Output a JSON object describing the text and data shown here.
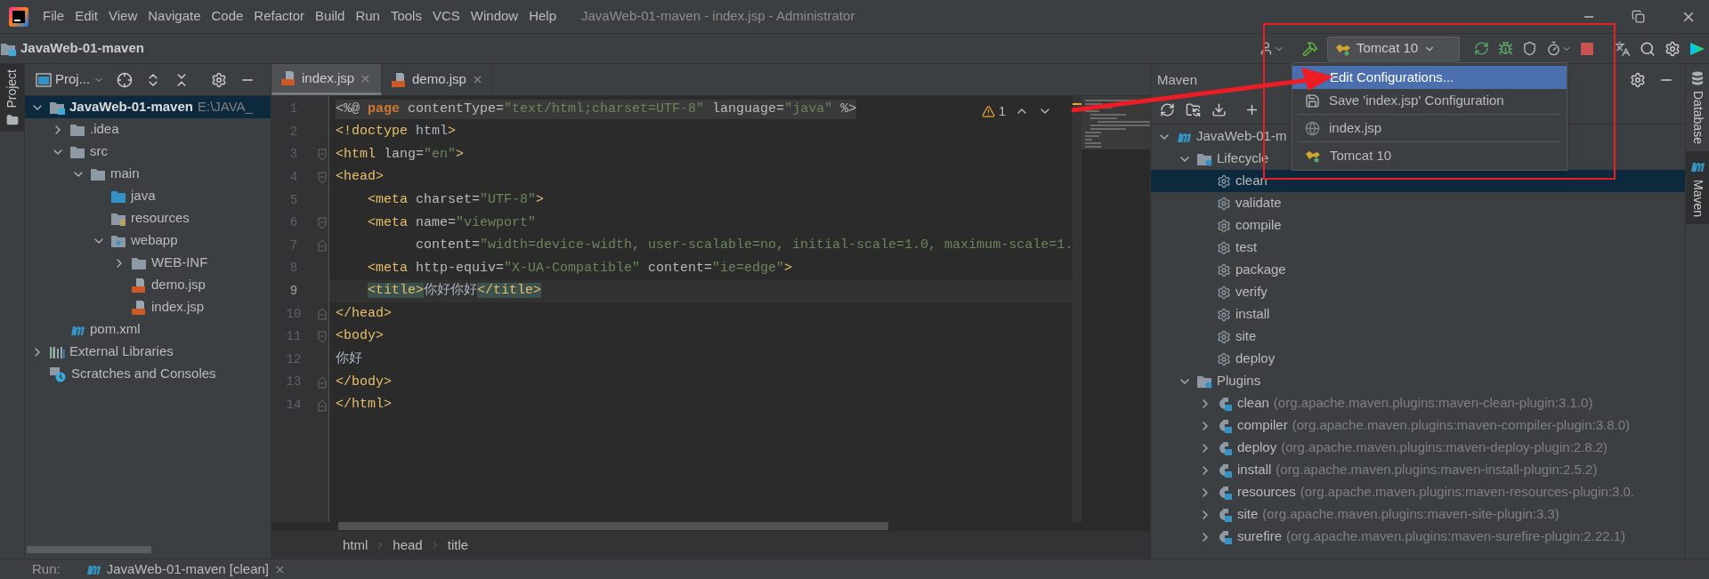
{
  "window": {
    "title": "JavaWeb-01-maven - index.jsp - Administrator"
  },
  "menu": {
    "items": [
      "File",
      "Edit",
      "View",
      "Navigate",
      "Code",
      "Refactor",
      "Build",
      "Run",
      "Tools",
      "VCS",
      "Window",
      "Help"
    ]
  },
  "navbar": {
    "project": "JavaWeb-01-maven"
  },
  "run_toolbar": {
    "configuration": "Tomcat 10"
  },
  "run_menu": {
    "items": [
      {
        "label": "Edit Configurations...",
        "kind": "edit",
        "selected": true
      },
      {
        "label": "Save 'index.jsp' Configuration",
        "kind": "save",
        "selected": false
      },
      {
        "label": "index.jsp",
        "kind": "jsp",
        "selected": false
      },
      {
        "label": "Tomcat 10",
        "kind": "tomcat",
        "selected": false
      }
    ]
  },
  "left_strip": {
    "tabs": [
      {
        "label": "Project",
        "selected": true
      }
    ]
  },
  "project_panel": {
    "title": "Proj...",
    "tree": [
      {
        "label": "JavaWeb-01-maven",
        "detail": "E:\\JAVA_",
        "kind": "module",
        "expanded": true,
        "selected": true,
        "children": [
          {
            "label": ".idea",
            "kind": "folder",
            "expanded": false,
            "selected": false
          },
          {
            "label": "src",
            "kind": "folder",
            "expanded": true,
            "selected": false,
            "children": [
              {
                "label": "main",
                "kind": "folder",
                "expanded": true,
                "selected": false,
                "children": [
                  {
                    "label": "java",
                    "kind": "source",
                    "selected": false
                  },
                  {
                    "label": "resources",
                    "kind": "resources",
                    "selected": false
                  },
                  {
                    "label": "webapp",
                    "kind": "web",
                    "expanded": true,
                    "selected": false,
                    "children": [
                      {
                        "label": "WEB-INF",
                        "kind": "folder",
                        "expanded": false,
                        "selected": false
                      },
                      {
                        "label": "demo.jsp",
                        "kind": "jsp",
                        "selected": false
                      },
                      {
                        "label": "index.jsp",
                        "kind": "jsp",
                        "selected": false
                      }
                    ]
                  }
                ]
              }
            ]
          },
          {
            "label": "pom.xml",
            "kind": "maven",
            "selected": false
          }
        ]
      },
      {
        "label": "External Libraries",
        "kind": "libraries",
        "expanded": false,
        "selected": false
      },
      {
        "label": "Scratches and Consoles",
        "kind": "scratches",
        "selected": false
      }
    ]
  },
  "editor": {
    "tabs": [
      {
        "label": "index.jsp",
        "selected": true
      },
      {
        "label": "demo.jsp",
        "selected": false
      }
    ],
    "warnings": "1",
    "lines": [
      {
        "number": "1",
        "kind": "directive",
        "current": false,
        "tokens": [
          {
            "text": "<%@ ",
            "kind": "punct"
          },
          {
            "text": "page",
            "kind": "keyword"
          },
          {
            "text": " contentType=",
            "kind": "attr"
          },
          {
            "text": "\"text/html;charset=UTF-8\"",
            "kind": "value"
          },
          {
            "text": " language=",
            "kind": "attr"
          },
          {
            "text": "\"java\"",
            "kind": "value"
          },
          {
            "text": " %>",
            "kind": "punct"
          }
        ]
      },
      {
        "number": "2",
        "current": false,
        "tokens": [
          {
            "text": "<!doctype",
            "kind": "tag"
          },
          {
            "text": " html",
            "kind": "text"
          },
          {
            "text": ">",
            "kind": "tag"
          }
        ]
      },
      {
        "number": "3",
        "fold_start": true,
        "current": false,
        "tokens": [
          {
            "text": "<html",
            "kind": "tag"
          },
          {
            "text": " lang=",
            "kind": "attr"
          },
          {
            "text": "\"en\"",
            "kind": "value"
          },
          {
            "text": ">",
            "kind": "tag"
          }
        ]
      },
      {
        "number": "4",
        "fold_start": true,
        "current": false,
        "tokens": [
          {
            "text": "<head>",
            "kind": "tag"
          }
        ]
      },
      {
        "number": "5",
        "current": false,
        "tokens": [
          {
            "text": "    <meta",
            "kind": "tag"
          },
          {
            "text": " charset=",
            "kind": "attr"
          },
          {
            "text": "\"UTF-8\"",
            "kind": "value"
          },
          {
            "text": ">",
            "kind": "tag"
          }
        ]
      },
      {
        "number": "6",
        "fold_start": true,
        "current": false,
        "tokens": [
          {
            "text": "    <meta",
            "kind": "tag"
          },
          {
            "text": " name=",
            "kind": "attr"
          },
          {
            "text": "\"viewport\"",
            "kind": "value"
          }
        ]
      },
      {
        "number": "7",
        "fold_end": true,
        "current": false,
        "tokens": [
          {
            "text": "          content=",
            "kind": "attr"
          },
          {
            "text": "\"width=device-width, user-scalable=no, initial-scale=1.0, maximum-scale=1.",
            "kind": "value"
          }
        ]
      },
      {
        "number": "8",
        "current": false,
        "tokens": [
          {
            "text": "    <meta",
            "kind": "tag"
          },
          {
            "text": " http-equiv=",
            "kind": "attr"
          },
          {
            "text": "\"X-UA-Compatible\"",
            "kind": "value"
          },
          {
            "text": " content=",
            "kind": "attr"
          },
          {
            "text": "\"ie=edge\"",
            "kind": "value"
          },
          {
            "text": ">",
            "kind": "tag"
          }
        ]
      },
      {
        "number": "9",
        "current": true,
        "indented": true,
        "tokens": [
          {
            "text": "<title>",
            "kind": "tag_match"
          },
          {
            "text": "你好你好",
            "kind": "text"
          },
          {
            "text": "</title>",
            "kind": "tag_match"
          }
        ]
      },
      {
        "number": "10",
        "fold_end": true,
        "current": false,
        "tokens": [
          {
            "text": "</head>",
            "kind": "tag"
          }
        ]
      },
      {
        "number": "11",
        "fold_start": true,
        "current": false,
        "tokens": [
          {
            "text": "<body>",
            "kind": "tag"
          }
        ]
      },
      {
        "number": "12",
        "current": false,
        "tokens": [
          {
            "text": "你好",
            "kind": "text"
          }
        ]
      },
      {
        "number": "13",
        "fold_end": true,
        "current": false,
        "tokens": [
          {
            "text": "</body>",
            "kind": "tag"
          }
        ]
      },
      {
        "number": "14",
        "fold_end": true,
        "current": false,
        "tokens": [
          {
            "text": "</html>",
            "kind": "tag"
          }
        ]
      }
    ],
    "breadcrumbs": [
      "html",
      "head",
      "title"
    ]
  },
  "maven_panel": {
    "title": "Maven",
    "tree": [
      {
        "label": "JavaWeb-01-m",
        "kind": "maven-module",
        "expanded": true,
        "selected": false,
        "children": [
          {
            "label": "Lifecycle",
            "kind": "lifecycle",
            "expanded": true,
            "selected": false,
            "children": [
              {
                "label": "clean",
                "kind": "goal",
                "selected": true
              },
              {
                "label": "validate",
                "kind": "goal",
                "selected": false
              },
              {
                "label": "compile",
                "kind": "goal",
                "selected": false
              },
              {
                "label": "test",
                "kind": "goal",
                "selected": false
              },
              {
                "label": "package",
                "kind": "goal",
                "selected": false
              },
              {
                "label": "verify",
                "kind": "goal",
                "selected": false
              },
              {
                "label": "install",
                "kind": "goal",
                "selected": false
              },
              {
                "label": "site",
                "kind": "goal",
                "selected": false
              },
              {
                "label": "deploy",
                "kind": "goal",
                "selected": false
              }
            ]
          },
          {
            "label": "Plugins",
            "kind": "lifecycle",
            "expanded": true,
            "selected": false,
            "children": [
              {
                "label": "clean",
                "detail": "(org.apache.maven.plugins:maven-clean-plugin:3.1.0)",
                "kind": "plugin",
                "expanded": false,
                "selected": false
              },
              {
                "label": "compiler",
                "detail": "(org.apache.maven.plugins:maven-compiler-plugin:3.8.0)",
                "kind": "plugin",
                "expanded": false,
                "selected": false
              },
              {
                "label": "deploy",
                "detail": "(org.apache.maven.plugins:maven-deploy-plugin:2.8.2)",
                "kind": "plugin",
                "expanded": false,
                "selected": false
              },
              {
                "label": "install",
                "detail": "(org.apache.maven.plugins:maven-install-plugin:2.5.2)",
                "kind": "plugin",
                "expanded": false,
                "selected": false
              },
              {
                "label": "resources",
                "detail": "(org.apache.maven.plugins:maven-resources-plugin:3.0.",
                "kind": "plugin",
                "expanded": false,
                "selected": false
              },
              {
                "label": "site",
                "detail": "(org.apache.maven.plugins:maven-site-plugin:3.3)",
                "kind": "plugin",
                "expanded": false,
                "selected": false
              },
              {
                "label": "surefire",
                "detail": "(org.apache.maven.plugins:maven-surefire-plugin:2.22.1)",
                "kind": "plugin",
                "expanded": false,
                "selected": false
              }
            ]
          }
        ]
      }
    ]
  },
  "right_strip": {
    "tabs": [
      {
        "label": "Database",
        "selected": false
      },
      {
        "label": "Maven",
        "selected": true
      }
    ]
  },
  "run_bar": {
    "label": "Run:",
    "tab": "JavaWeb-01-maven [clean]"
  }
}
